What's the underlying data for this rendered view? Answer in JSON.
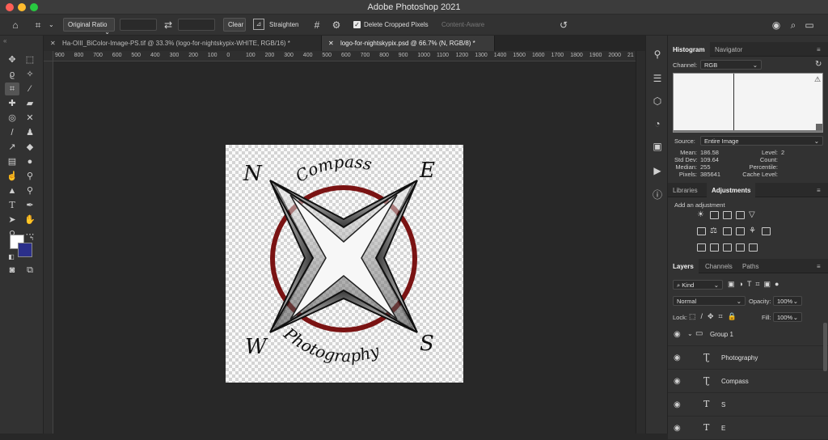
{
  "window": {
    "title": "Adobe Photoshop 2021"
  },
  "options_bar": {
    "ratio_select": "Original Ratio",
    "clear_label": "Clear",
    "straighten_label": "Straighten",
    "delete_cropped_label": "Delete Cropped Pixels",
    "delete_cropped_checked": true,
    "content_aware_label": "Content-Aware"
  },
  "tabs": [
    {
      "label": "Ha-OIII_BiColor-Image-PS.tif @ 33.3% (logo-for-nightskypix-WHITE, RGB/16) *",
      "active": false
    },
    {
      "label": "logo-for-nightskypix.psd @ 66.7% (N, RGB/8) *",
      "active": true
    }
  ],
  "ruler_ticks": [
    "900",
    "800",
    "700",
    "600",
    "500",
    "400",
    "300",
    "200",
    "100",
    "0",
    "100",
    "200",
    "300",
    "400",
    "500",
    "600",
    "700",
    "800",
    "900",
    "1000",
    "1100",
    "1200",
    "1300",
    "1400",
    "1500",
    "1600",
    "1700",
    "1800",
    "1900",
    "2000",
    "21"
  ],
  "logo": {
    "letters": {
      "n": "N",
      "e": "E",
      "w": "W",
      "s": "S"
    },
    "top_text": "Compass",
    "bottom_text": "Photography",
    "ring_color": "#7a1313"
  },
  "histogram_panel": {
    "tabs": [
      "Histogram",
      "Navigator"
    ],
    "channel_label": "Channel:",
    "channel_value": "RGB",
    "source_label": "Source:",
    "source_value": "Entire Image",
    "stats_left": [
      {
        "label": "Mean:",
        "value": "186.58"
      },
      {
        "label": "Std Dev:",
        "value": "109.64"
      },
      {
        "label": "Median:",
        "value": "255"
      },
      {
        "label": "Pixels:",
        "value": "385641"
      }
    ],
    "stats_right": [
      {
        "label": "Level:",
        "value": ""
      },
      {
        "label": "Count:",
        "value": ""
      },
      {
        "label": "Percentile:",
        "value": ""
      },
      {
        "label": "Cache Level:",
        "value": "2"
      }
    ]
  },
  "adjustments_panel": {
    "tabs": [
      "Libraries",
      "Adjustments"
    ],
    "add_label": "Add an adjustment"
  },
  "layers_panel": {
    "tabs": [
      "Layers",
      "Channels",
      "Paths"
    ],
    "filter_value": "Kind",
    "blend_mode": "Normal",
    "opacity_label": "Opacity:",
    "opacity_value": "100%",
    "lock_label": "Lock:",
    "fill_label": "Fill:",
    "fill_value": "100%",
    "layers": [
      {
        "name": "Group 1",
        "kind": "group"
      },
      {
        "name": "Photography",
        "kind": "warped-text"
      },
      {
        "name": "Compass",
        "kind": "warped-text"
      },
      {
        "name": "S",
        "kind": "text"
      },
      {
        "name": "E",
        "kind": "text"
      }
    ]
  }
}
